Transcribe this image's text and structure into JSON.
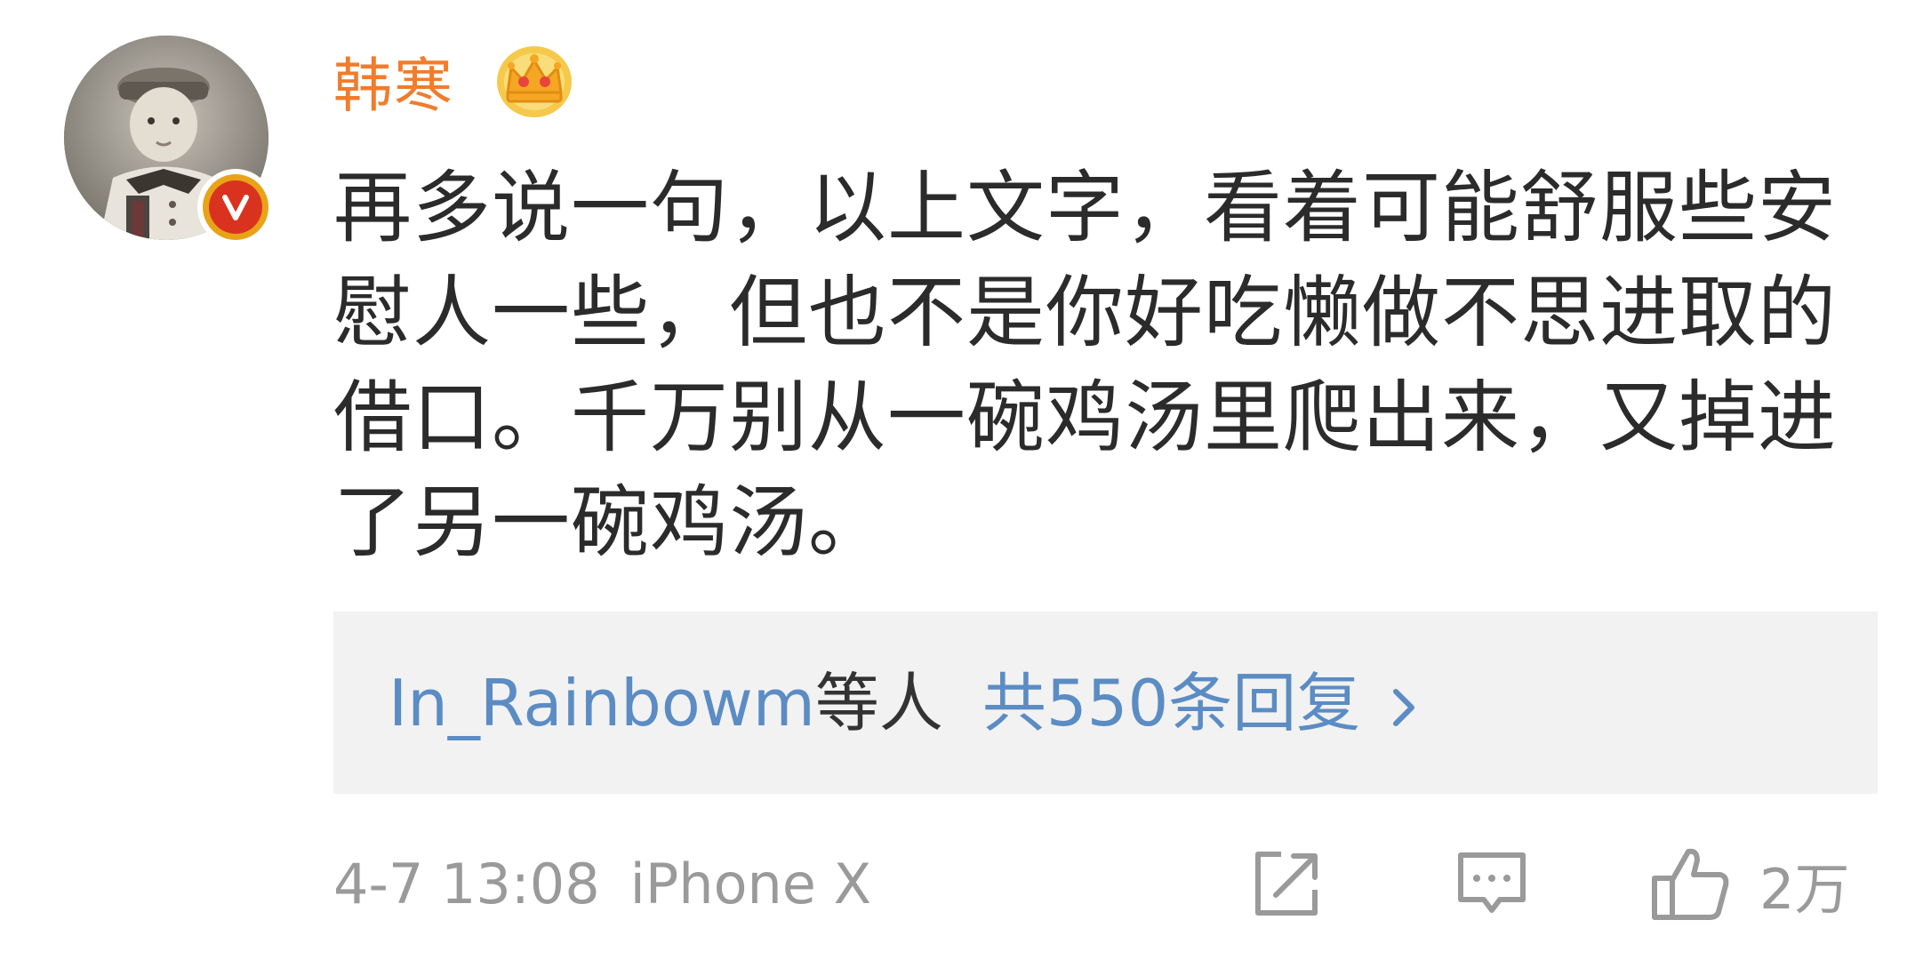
{
  "user": {
    "name": "韩寒",
    "avatar": "child-portrait-avatar",
    "badge": "verified-v-icon",
    "crown": "crown-icon",
    "name_color": "#f07c2c"
  },
  "comment": {
    "text": "再多说一句，以上文字，看着可能舒服些安慰人一些，但也不是你好吃懒做不思进取的借口。千万别从一碗鸡汤里爬出来，又掉进了另一碗鸡汤。"
  },
  "replies": {
    "users": "In_Rainbowm",
    "suffix": "等人",
    "count_label": "共550条回复",
    "link_color": "#5b8cc4"
  },
  "meta": {
    "timestamp": "4-7 13:08",
    "device": "iPhone X"
  },
  "actions": {
    "share_icon": "share-icon",
    "comment_icon": "comment-icon",
    "like_icon": "thumbs-up-icon",
    "like_count": "2万"
  }
}
